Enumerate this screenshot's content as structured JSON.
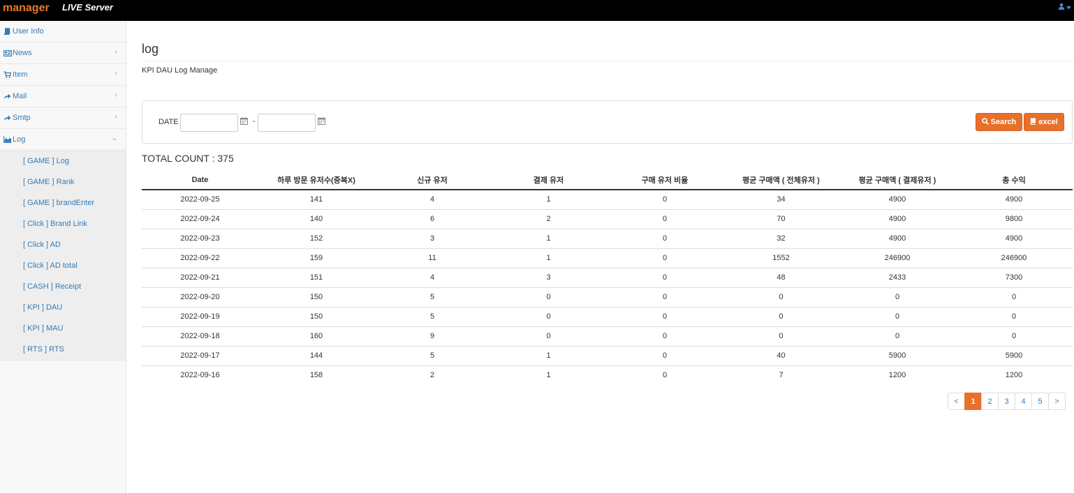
{
  "header": {
    "brand": "manager",
    "server": "LIVE Server",
    "user_icon": "user-icon"
  },
  "sidebar": {
    "items": [
      {
        "label": "User Info",
        "icon": "book-icon",
        "chevron": ""
      },
      {
        "label": "News",
        "icon": "newspaper-icon",
        "chevron": "‹"
      },
      {
        "label": "Item",
        "icon": "cart-icon",
        "chevron": "‹"
      },
      {
        "label": "Mail",
        "icon": "share-icon",
        "chevron": "‹"
      },
      {
        "label": "Smtp",
        "icon": "share-icon",
        "chevron": "‹"
      },
      {
        "label": "Log",
        "icon": "area-chart-icon",
        "chevron": "⌄"
      }
    ],
    "log_sub": [
      "[ GAME ] Log",
      "[ GAME ] Rank",
      "[ GAME ] brandEnter",
      "[ Click ] Brand Link",
      "[ Click ] AD",
      "[ Click ] AD total",
      "[ CASH ] Receipt",
      "[ KPI ] DAU",
      "[ KPI ] MAU",
      "[ RTS ] RTS"
    ]
  },
  "page": {
    "title": "log",
    "subtitle": "KPI DAU Log Manage"
  },
  "search": {
    "date_label": "DATE",
    "start_value": "",
    "end_value": "",
    "dash": "-",
    "search_label": "Search",
    "excel_label": "excel"
  },
  "total": "TOTAL COUNT : 375",
  "table": {
    "headers": [
      "Date",
      "하루 방문 유저수(중복X)",
      "신규 유저",
      "결제 유저",
      "구매 유저 비율",
      "평균 구매액 ( 전체유저 )",
      "평균 구매액 ( 결제유저 )",
      "총 수익"
    ],
    "rows": [
      [
        "2022-09-25",
        "141",
        "4",
        "1",
        "0",
        "34",
        "4900",
        "4900"
      ],
      [
        "2022-09-24",
        "140",
        "6",
        "2",
        "0",
        "70",
        "4900",
        "9800"
      ],
      [
        "2022-09-23",
        "152",
        "3",
        "1",
        "0",
        "32",
        "4900",
        "4900"
      ],
      [
        "2022-09-22",
        "159",
        "11",
        "1",
        "0",
        "1552",
        "246900",
        "246900"
      ],
      [
        "2022-09-21",
        "151",
        "4",
        "3",
        "0",
        "48",
        "2433",
        "7300"
      ],
      [
        "2022-09-20",
        "150",
        "5",
        "0",
        "0",
        "0",
        "0",
        "0"
      ],
      [
        "2022-09-19",
        "150",
        "5",
        "0",
        "0",
        "0",
        "0",
        "0"
      ],
      [
        "2022-09-18",
        "160",
        "9",
        "0",
        "0",
        "0",
        "0",
        "0"
      ],
      [
        "2022-09-17",
        "144",
        "5",
        "1",
        "0",
        "40",
        "5900",
        "5900"
      ],
      [
        "2022-09-16",
        "158",
        "2",
        "1",
        "0",
        "7",
        "1200",
        "1200"
      ]
    ]
  },
  "pagination": {
    "prev": "<",
    "pages": [
      "1",
      "2",
      "3",
      "4",
      "5"
    ],
    "active": "1",
    "next": ">"
  },
  "colors": {
    "accent": "#e8702a",
    "link": "#337ab7",
    "brand": "#e8782a"
  }
}
